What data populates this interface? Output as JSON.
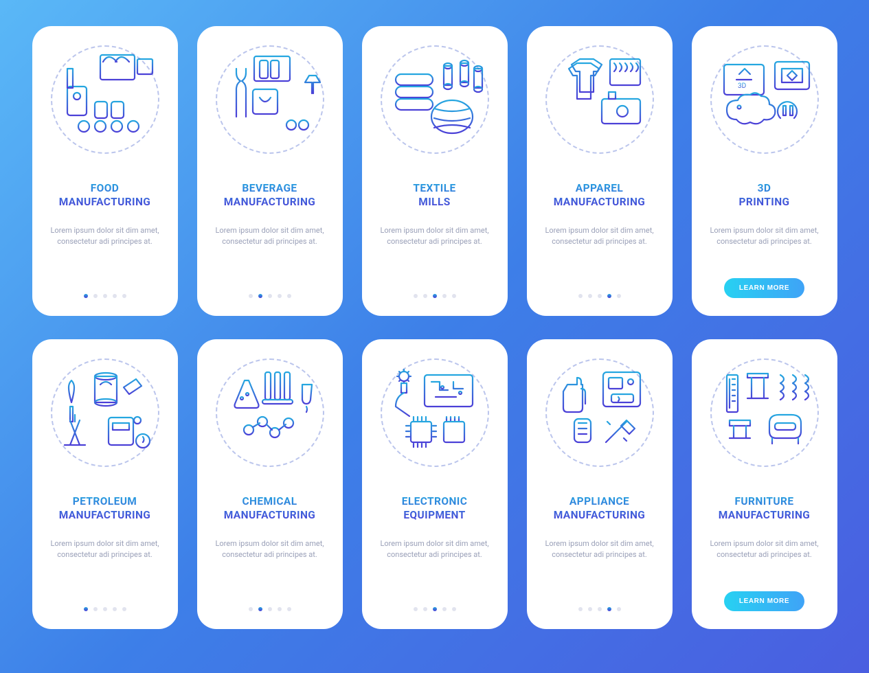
{
  "body_text": "Lorem ipsum dolor sit dim amet, consectetur adi principes at.",
  "learn_more_label": "LEARN MORE",
  "colors": {
    "gradient_top": "#24A7E0",
    "gradient_bottom": "#4B3FD7",
    "button_gradient_left": "#27D1F2",
    "button_gradient_right": "#3FA3F7"
  },
  "cards": [
    {
      "id": "food",
      "title": "FOOD\nMANUFACTURING",
      "dots_total": 5,
      "active_dot": 0,
      "has_button": false,
      "icon": "food-icon"
    },
    {
      "id": "beverage",
      "title": "BEVERAGE\nMANUFACTURING",
      "dots_total": 5,
      "active_dot": 1,
      "has_button": false,
      "icon": "beverage-icon"
    },
    {
      "id": "textile",
      "title": "TEXTILE\nMILLS",
      "dots_total": 5,
      "active_dot": 2,
      "has_button": false,
      "icon": "textile-icon"
    },
    {
      "id": "apparel",
      "title": "APPAREL\nMANUFACTURING",
      "dots_total": 5,
      "active_dot": 3,
      "has_button": false,
      "icon": "apparel-icon"
    },
    {
      "id": "printing",
      "title": "3D\nPRINTING",
      "dots_total": 0,
      "active_dot": -1,
      "has_button": true,
      "icon": "printing-icon"
    },
    {
      "id": "petroleum",
      "title": "PETROLEUM\nMANUFACTURING",
      "dots_total": 5,
      "active_dot": 0,
      "has_button": false,
      "icon": "petroleum-icon"
    },
    {
      "id": "chemical",
      "title": "CHEMICAL\nMANUFACTURING",
      "dots_total": 5,
      "active_dot": 1,
      "has_button": false,
      "icon": "chemical-icon"
    },
    {
      "id": "electronic",
      "title": "ELECTRONIC\nEQUIPMENT",
      "dots_total": 5,
      "active_dot": 2,
      "has_button": false,
      "icon": "electronic-icon"
    },
    {
      "id": "appliance",
      "title": "APPLIANCE\nMANUFACTURING",
      "dots_total": 5,
      "active_dot": 3,
      "has_button": false,
      "icon": "appliance-icon"
    },
    {
      "id": "furniture",
      "title": "FURNITURE\nMANUFACTURING",
      "dots_total": 0,
      "active_dot": -1,
      "has_button": true,
      "icon": "furniture-icon"
    }
  ]
}
